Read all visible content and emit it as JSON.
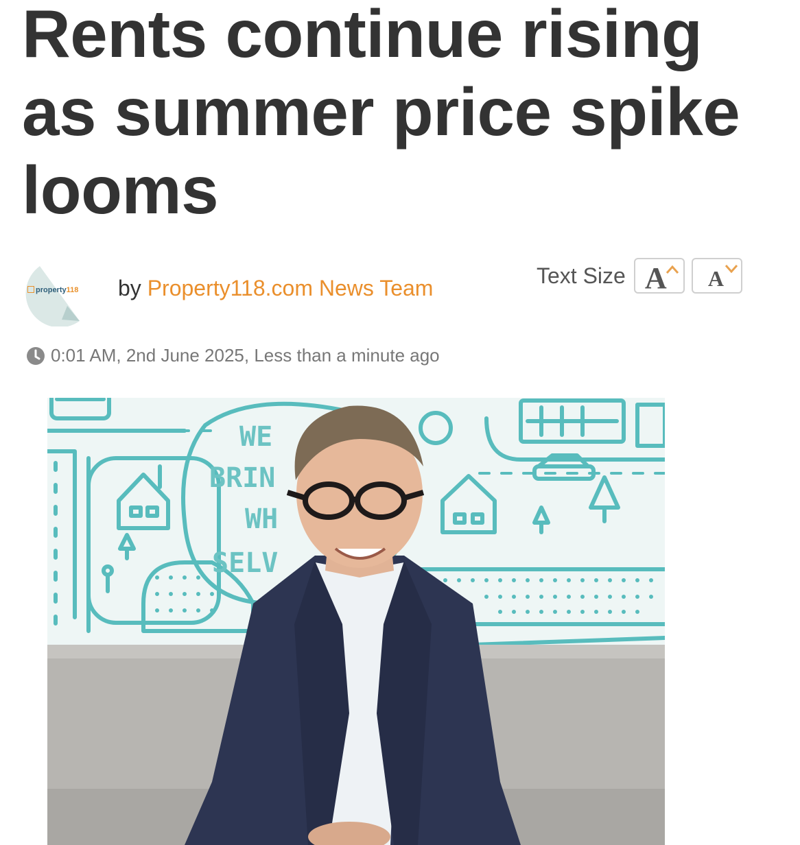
{
  "article": {
    "title": "Rents continue rising as summer price spike looms",
    "byline_prefix": "by",
    "author": "Property118.com News Team",
    "timestamp": "0:01 AM, 2nd June 2025, Less than a minute ago"
  },
  "logo": {
    "text_main": "property",
    "text_num": "118",
    "icon": "house-icon"
  },
  "text_size": {
    "label": "Text Size",
    "increase_glyph": "A",
    "decrease_glyph": "A",
    "increase_icon": "chevron-up-icon",
    "decrease_icon": "chevron-down-icon"
  },
  "wall_lettering": [
    "WE",
    "BRIN",
    "WH",
    "SELV"
  ],
  "colors": {
    "title": "#333333",
    "accent": "#ea8f2c",
    "meta": "#777777",
    "mural": "#4fb8b9"
  }
}
